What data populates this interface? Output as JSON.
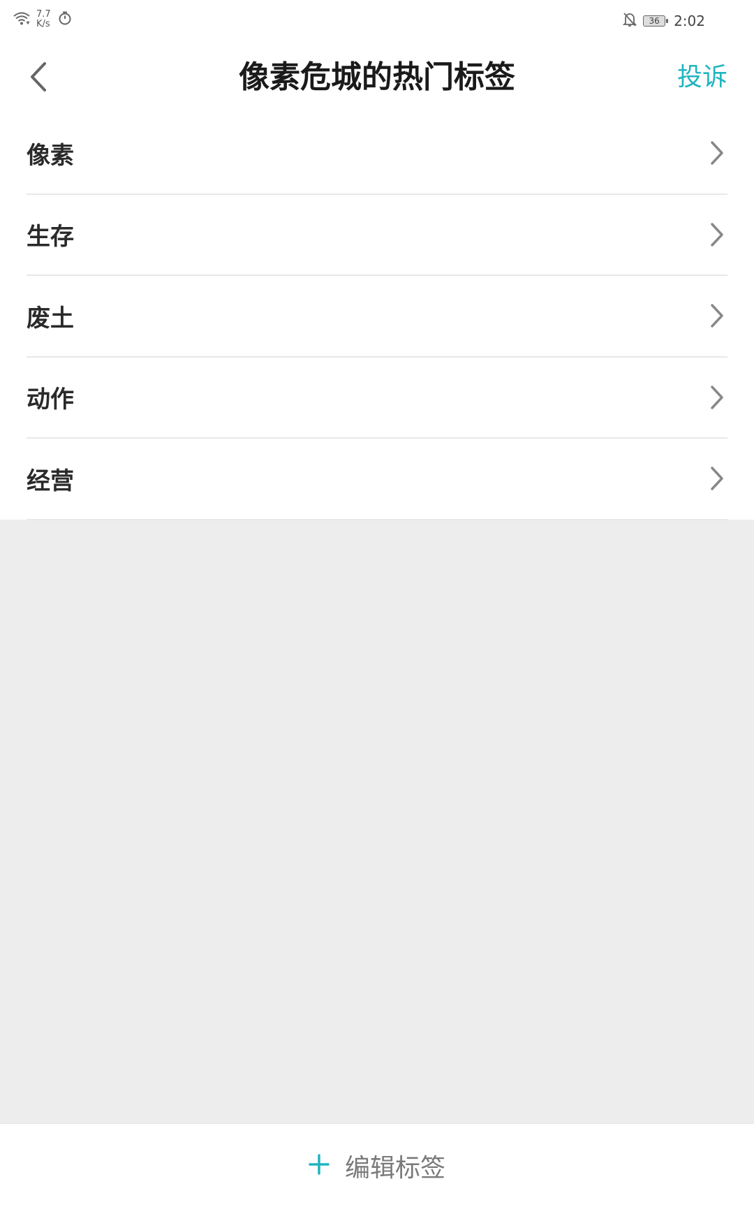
{
  "status_bar": {
    "net_speed_value": "7.7",
    "net_speed_unit": "K/s",
    "battery": "36",
    "time": "2:02",
    "icons": [
      "wifi-icon",
      "timer-icon",
      "bell-off-icon",
      "battery-icon"
    ]
  },
  "header": {
    "back_icon": "chevron-left-icon",
    "title": "像素危城的热门标签",
    "report_label": "投诉"
  },
  "tags": [
    {
      "label": "像素"
    },
    {
      "label": "生存"
    },
    {
      "label": "废土"
    },
    {
      "label": "动作"
    },
    {
      "label": "经营"
    }
  ],
  "bottom": {
    "edit_label": "编辑标签",
    "plus_icon": "plus-icon"
  },
  "colors": {
    "accent": "#1fb5c0",
    "background": "#ededed",
    "surface": "#ffffff",
    "text_primary": "#1a1a1a",
    "text_secondary": "#7a7a7a",
    "divider": "#e8e8e8"
  }
}
